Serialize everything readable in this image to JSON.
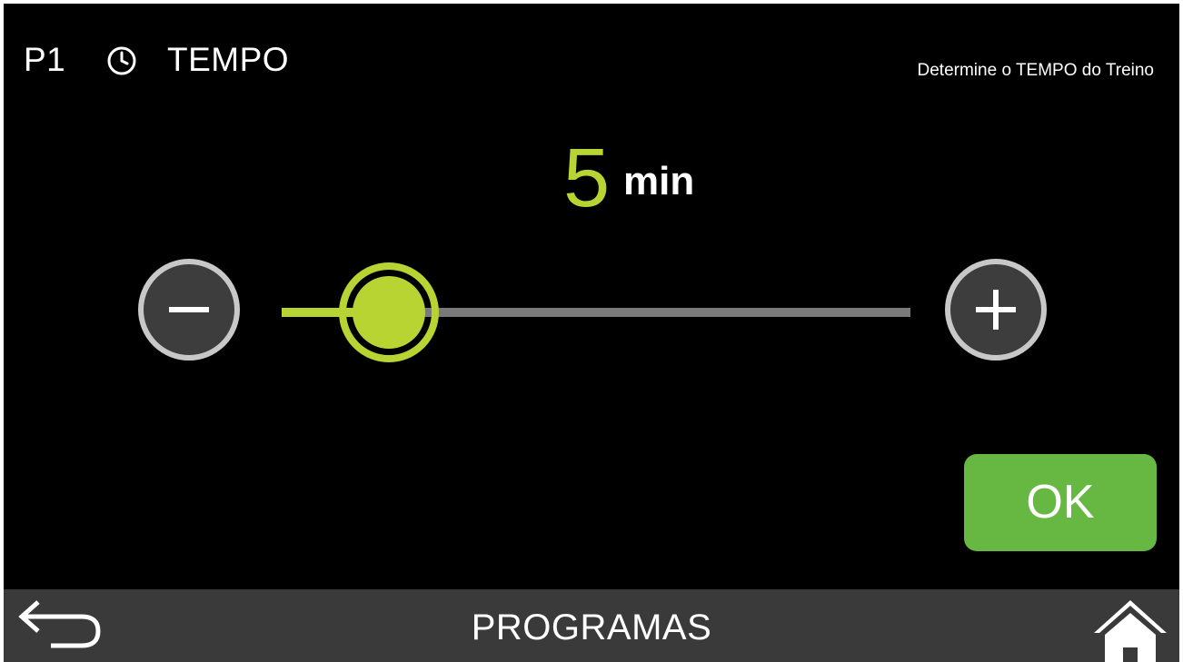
{
  "header": {
    "program": "P1",
    "icon": "clock-icon",
    "title": "TEMPO",
    "hint": "Determine o TEMPO do Treino"
  },
  "time_setting": {
    "value": "5",
    "unit": "min",
    "slider_fraction": 0.05
  },
  "controls": {
    "decrease_icon": "minus-icon",
    "increase_icon": "plus-icon",
    "ok_label": "OK"
  },
  "bottom_bar": {
    "title": "PROGRAMAS",
    "back_icon": "back-arrow-icon",
    "home_icon": "home-icon"
  },
  "colors": {
    "accent": "#b7d433",
    "ok_button": "#66b843",
    "track": "#7a7a7a",
    "bottom_bar": "#3a3a3a"
  }
}
